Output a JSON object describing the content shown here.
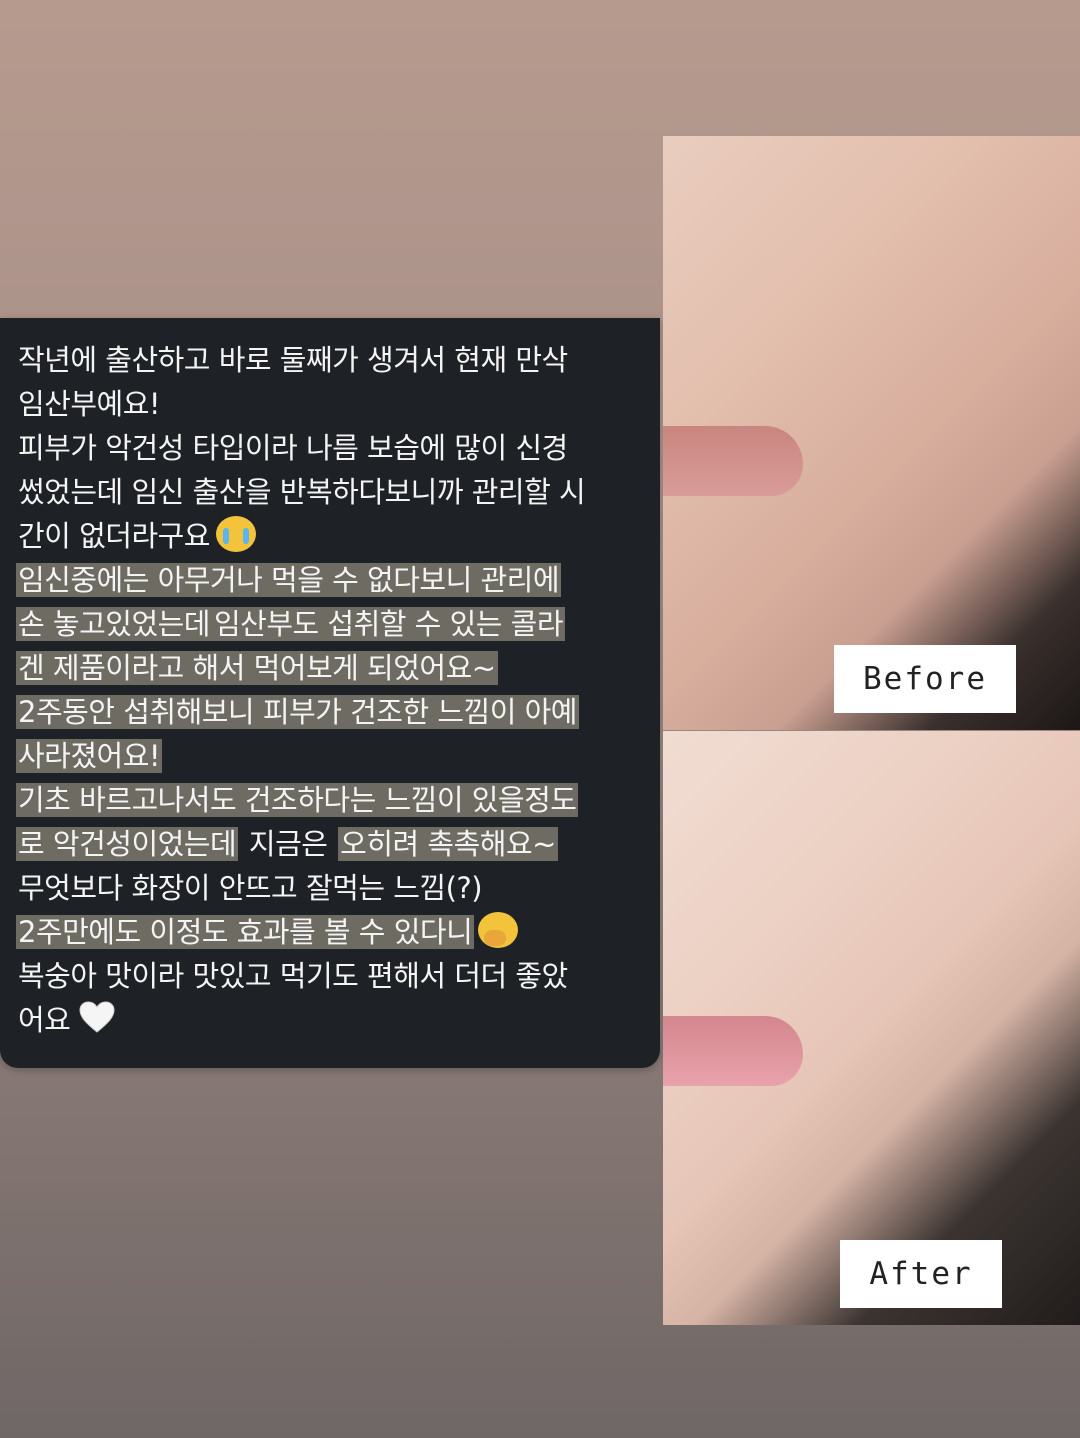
{
  "review": {
    "lines": [
      {
        "segments": [
          {
            "text": "작년에 출산하고 바로 둘째가 생겨서 현재 만삭",
            "hl": false
          }
        ]
      },
      {
        "segments": [
          {
            "text": "임산부예요!",
            "hl": false
          }
        ]
      },
      {
        "segments": [
          {
            "text": "피부가 악건성 타입이라 나름 보습에 많이 신경",
            "hl": false
          }
        ]
      },
      {
        "segments": [
          {
            "text": "썼었는데 임신 출산을 반복하다보니까 관리할 시",
            "hl": false
          }
        ]
      },
      {
        "segments": [
          {
            "text": "간이 없더라구요",
            "hl": false
          }
        ],
        "emoji": "loudly-crying-face-icon"
      },
      {
        "segments": [
          {
            "text": "임신중에는 아무거나 먹을 수 없다보니 관리에",
            "hl": true
          }
        ]
      },
      {
        "segments": [
          {
            "text": "손 놓고있었는데",
            "hl": true
          },
          {
            "text": "임산부도 섭취할 수 있는 콜라",
            "hl": true
          }
        ]
      },
      {
        "segments": [
          {
            "text": "겐 제품이라고 해서 먹어보게 되었어요~",
            "hl": true
          }
        ]
      },
      {
        "segments": [
          {
            "text": "2주동안 섭취해보니 피부가 건조한 느낌이 아예",
            "hl": true
          }
        ]
      },
      {
        "segments": [
          {
            "text": "사라졌어요!",
            "hl": true
          }
        ]
      },
      {
        "segments": [
          {
            "text": "기초 바르고나서도 건조하다는 느낌이 있을정도",
            "hl": true
          }
        ]
      },
      {
        "segments": [
          {
            "text": "로 악건성이었는데",
            "hl": true
          },
          {
            "text": " 지금은 ",
            "hl": false
          },
          {
            "text": "오히려 촉촉해요~",
            "hl": true
          }
        ]
      },
      {
        "segments": [
          {
            "text": "무엇보다 화장이 안뜨고 잘먹는 느낌(?)",
            "hl": false
          }
        ]
      },
      {
        "segments": [
          {
            "text": "2주만에도 이정도 효과를 볼 수 있다니",
            "hl": true
          }
        ],
        "emoji": "face-with-hand-over-mouth-icon"
      },
      {
        "segments": [
          {
            "text": "복숭아 맛이라 맛있고 먹기도 편해서 더더 좋았",
            "hl": false
          }
        ]
      },
      {
        "segments": [
          {
            "text": "어요",
            "hl": false
          }
        ],
        "emoji": "white-heart-icon"
      }
    ]
  },
  "photos": {
    "before_label": "Before",
    "after_label": "After"
  }
}
